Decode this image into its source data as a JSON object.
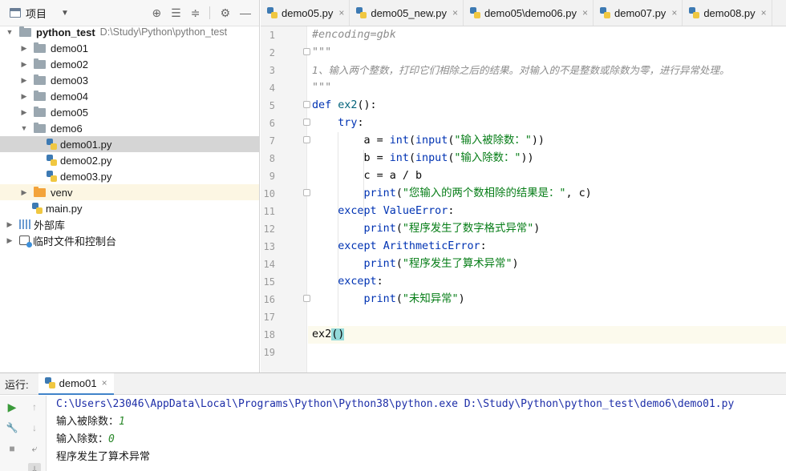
{
  "project": {
    "title": "项目",
    "root_name": "python_test",
    "root_path": "D:\\Study\\Python\\python_test",
    "items": [
      {
        "label": "demo01",
        "type": "folder"
      },
      {
        "label": "demo02",
        "type": "folder"
      },
      {
        "label": "demo03",
        "type": "folder"
      },
      {
        "label": "demo04",
        "type": "folder"
      },
      {
        "label": "demo05",
        "type": "folder"
      },
      {
        "label": "demo6",
        "type": "folder-open"
      },
      {
        "label": "demo01.py",
        "type": "py"
      },
      {
        "label": "demo02.py",
        "type": "py"
      },
      {
        "label": "demo03.py",
        "type": "py"
      },
      {
        "label": "venv",
        "type": "folder-excluded"
      },
      {
        "label": "main.py",
        "type": "py"
      },
      {
        "label": "外部库",
        "type": "library"
      },
      {
        "label": "临时文件和控制台",
        "type": "scratches"
      }
    ]
  },
  "tabs": [
    {
      "label": "demo05.py"
    },
    {
      "label": "demo05_new.py"
    },
    {
      "label": "demo05\\demo06.py"
    },
    {
      "label": "demo07.py"
    },
    {
      "label": "demo08.py"
    }
  ],
  "code": {
    "line_numbers": [
      "1",
      "2",
      "3",
      "4",
      "5",
      "6",
      "7",
      "8",
      "9",
      "10",
      "11",
      "12",
      "13",
      "14",
      "15",
      "16",
      "17",
      "18",
      "19"
    ],
    "l1": "#encoding=gbk",
    "l2": "\"\"\"",
    "l3": "1、输入两个整数，打印它们相除之后的结果。对输入的不是整数或除数为零，进行异常处理。",
    "l4": "\"\"\"",
    "l5_kw": "def",
    "l5_name": "ex2",
    "l5_rest": "():",
    "l6_kw": "try",
    "l6_rest": ":",
    "l7_a": "a = ",
    "l7_int": "int",
    "l7_p1": "(",
    "l7_input": "input",
    "l7_p2": "(",
    "l7_str": "\"输入被除数：\"",
    "l7_end": "))",
    "l8_a": "b = ",
    "l8_int": "int",
    "l8_p1": "(",
    "l8_input": "input",
    "l8_p2": "(",
    "l8_str": "\"输入除数：\"",
    "l8_end": "))",
    "l9": "c = a / b",
    "l10_print": "print",
    "l10_p": "(",
    "l10_str": "\"您输入的两个数相除的结果是：\"",
    "l10_end": ", c)",
    "l11_kw": "except",
    "l11_exc": "ValueError",
    "l11_end": ":",
    "l12_print": "print",
    "l12_p": "(",
    "l12_str": "\"程序发生了数字格式异常\"",
    "l12_end": ")",
    "l13_kw": "except",
    "l13_exc": "ArithmeticError",
    "l13_end": ":",
    "l14_print": "print",
    "l14_p": "(",
    "l14_str": "\"程序发生了算术异常\"",
    "l14_end": ")",
    "l15_kw": "except",
    "l15_end": ":",
    "l16_print": "print",
    "l16_p": "(",
    "l16_str": "\"未知异常\"",
    "l16_end": ")",
    "l18_name": "ex2",
    "l18_p1": "(",
    "l18_p2": ")"
  },
  "run": {
    "label": "运行:",
    "tab": "demo01",
    "console": {
      "cmd": "C:\\Users\\23046\\AppData\\Local\\Programs\\Python\\Python38\\python.exe D:\\Study\\Python\\python_test\\demo6\\demo01.py",
      "prompt1": "输入被除数：",
      "input1": "1",
      "prompt2": "输入除数：",
      "input2": "0",
      "output": "程序发生了算术异常"
    }
  },
  "icons": {
    "close": "×",
    "collapse": "▾",
    "expand": "▸"
  }
}
